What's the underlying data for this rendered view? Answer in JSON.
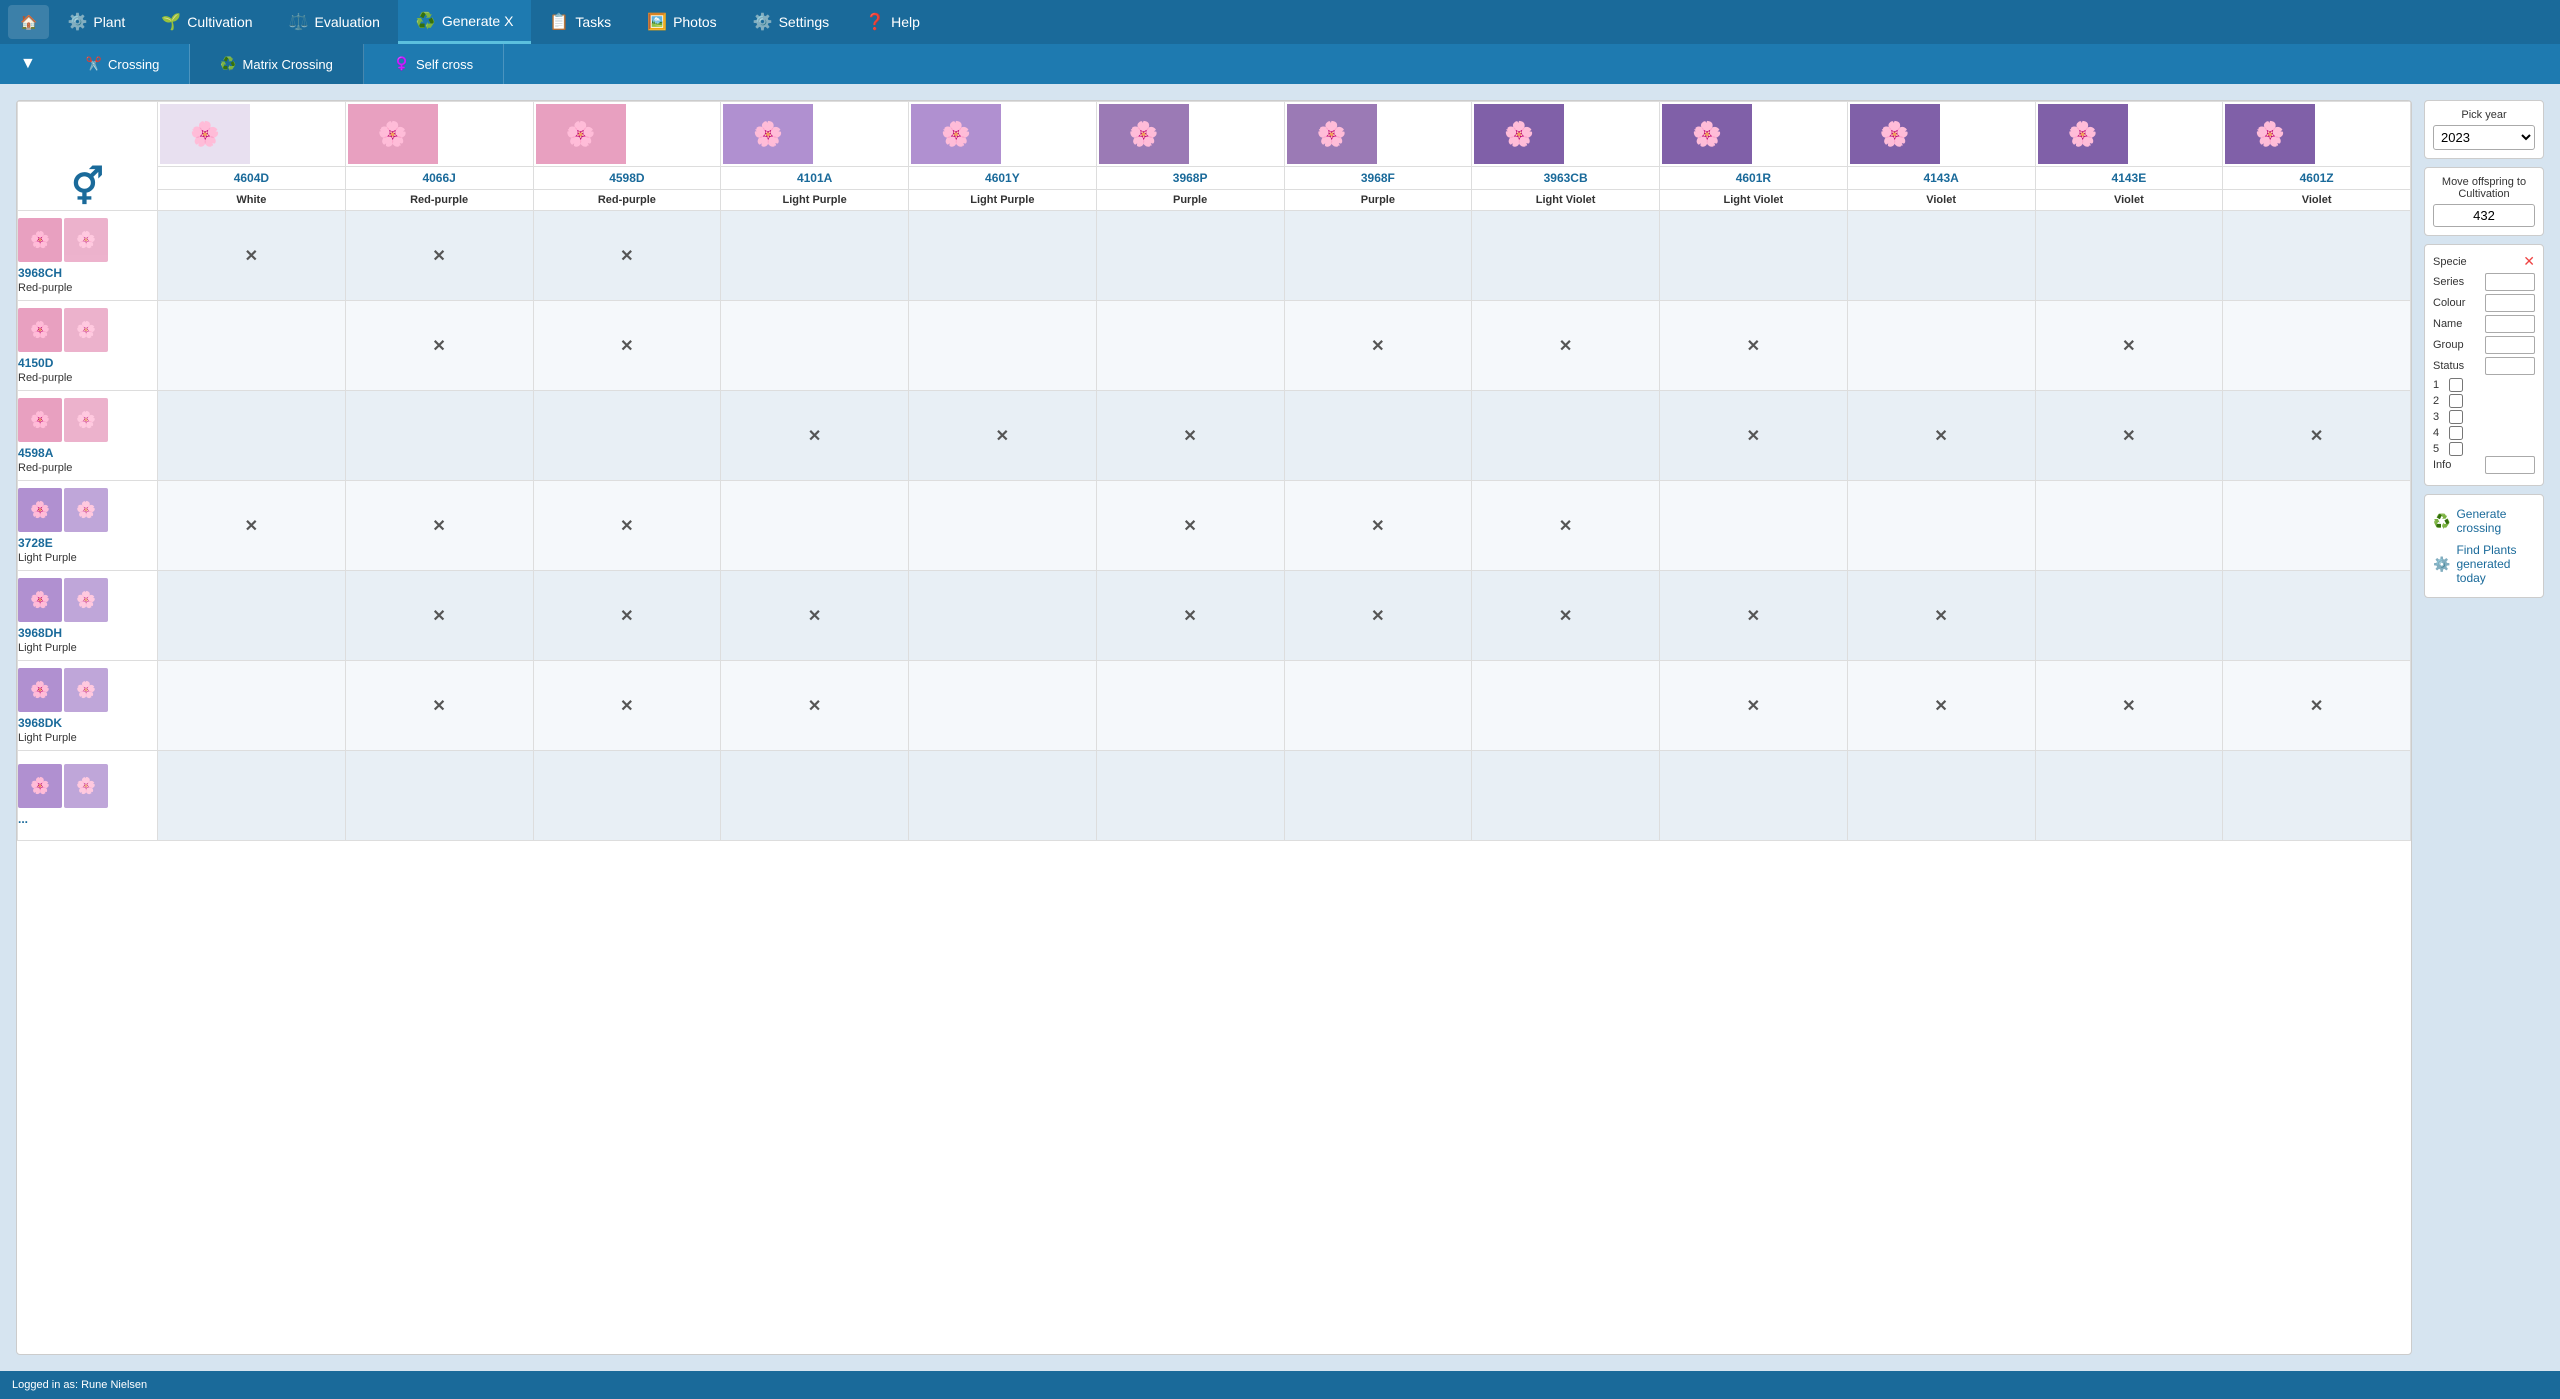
{
  "nav": {
    "home_icon": "🏠",
    "items": [
      {
        "label": "Plant",
        "icon": "⚙️",
        "active": false
      },
      {
        "label": "Cultivation",
        "icon": "🌱",
        "active": false
      },
      {
        "label": "Evaluation",
        "icon": "⚖️",
        "active": false
      },
      {
        "label": "Generate X",
        "icon": "♻️",
        "active": true
      },
      {
        "label": "Tasks",
        "icon": "📋",
        "active": false
      },
      {
        "label": "Photos",
        "icon": "🖼️",
        "active": false
      },
      {
        "label": "Settings",
        "icon": "⚙️",
        "active": false
      },
      {
        "label": "Help",
        "icon": "❓",
        "active": false
      }
    ]
  },
  "subnav": {
    "dropdown_icon": "▼",
    "items": [
      {
        "label": "Crossing",
        "icon": "✂️",
        "active": false
      },
      {
        "label": "Matrix Crossing",
        "icon": "♻️",
        "active": true
      },
      {
        "label": "Self cross",
        "icon": "♀️",
        "active": false
      }
    ]
  },
  "matrix": {
    "corner_icon": "⚥",
    "columns": [
      {
        "id": "4604D",
        "color": "White",
        "flower_style": "flower-white"
      },
      {
        "id": "4066J",
        "color": "Red-purple",
        "flower_style": "flower-pink"
      },
      {
        "id": "4598D",
        "color": "Red-purple",
        "flower_style": "flower-pink"
      },
      {
        "id": "4101A",
        "color": "Light Purple",
        "flower_style": "flower-lavender"
      },
      {
        "id": "4601Y",
        "color": "Light Purple",
        "flower_style": "flower-lavender"
      },
      {
        "id": "3968P",
        "color": "Purple",
        "flower_style": "flower-purple"
      },
      {
        "id": "3968F",
        "color": "Purple",
        "flower_style": "flower-purple"
      },
      {
        "id": "3963CB",
        "color": "Light Violet",
        "flower_style": "flower-violet"
      },
      {
        "id": "4601R",
        "color": "Light Violet",
        "flower_style": "flower-violet"
      },
      {
        "id": "4143A",
        "color": "Violet",
        "flower_style": "flower-violet"
      },
      {
        "id": "4143E",
        "color": "Violet",
        "flower_style": "flower-violet"
      },
      {
        "id": "4601Z",
        "color": "Violet",
        "flower_style": "flower-violet"
      }
    ],
    "rows": [
      {
        "id": "3968CH",
        "color": "Red-purple",
        "flower_style": "flower-pink",
        "crosses": [
          true,
          true,
          true,
          false,
          false,
          false,
          false,
          false,
          false,
          false,
          false,
          false
        ]
      },
      {
        "id": "4150D",
        "color": "Red-purple",
        "flower_style": "flower-pink",
        "crosses": [
          false,
          true,
          true,
          false,
          false,
          false,
          true,
          true,
          true,
          false,
          true,
          false
        ]
      },
      {
        "id": "4598A",
        "color": "Red-purple",
        "flower_style": "flower-pink",
        "crosses": [
          false,
          false,
          false,
          true,
          true,
          true,
          false,
          false,
          true,
          true,
          true,
          true
        ]
      },
      {
        "id": "3728E",
        "color": "Light Purple",
        "flower_style": "flower-lavender",
        "crosses": [
          true,
          true,
          true,
          false,
          false,
          true,
          true,
          true,
          false,
          false,
          false,
          false
        ]
      },
      {
        "id": "3968DH",
        "color": "Light Purple",
        "flower_style": "flower-lavender",
        "crosses": [
          false,
          true,
          true,
          true,
          false,
          true,
          true,
          true,
          true,
          true,
          false,
          false
        ]
      },
      {
        "id": "3968DK",
        "color": "Light Purple",
        "flower_style": "flower-lavender",
        "crosses": [
          false,
          true,
          true,
          true,
          false,
          false,
          false,
          false,
          true,
          true,
          true,
          true
        ]
      },
      {
        "id": "...",
        "color": "",
        "flower_style": "flower-lavender",
        "crosses": [
          false,
          false,
          false,
          false,
          false,
          false,
          false,
          false,
          false,
          false,
          false,
          false
        ]
      }
    ]
  },
  "right_panel": {
    "pick_year_label": "Pick year",
    "year_value": "2023",
    "offspring_label": "Move offspring to Cultivation",
    "offspring_value": "432",
    "filters": {
      "specie_label": "Specie",
      "series_label": "Series",
      "colour_label": "Colour",
      "name_label": "Name",
      "group_label": "Group",
      "status_label": "Status",
      "numbers": [
        "1",
        "2",
        "3",
        "4",
        "5"
      ],
      "info_label": "Info"
    },
    "actions": [
      {
        "label": "Generate crossing",
        "icon": "♻️"
      },
      {
        "label": "Find Plants generated today",
        "icon": "⚙️"
      }
    ]
  },
  "status_bar": {
    "text": "Logged in as: Rune Nielsen"
  }
}
